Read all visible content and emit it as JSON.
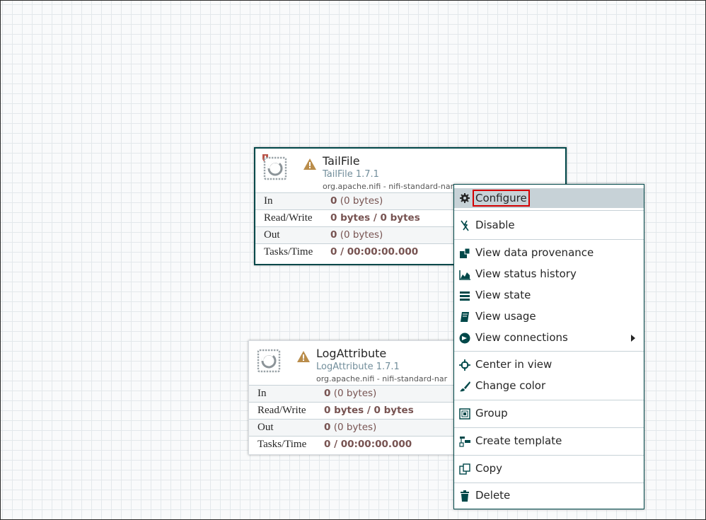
{
  "processors": {
    "tailfile": {
      "name": "TailFile",
      "type": "TailFile 1.7.1",
      "bundle": "org.apache.nifi - nifi-standard-nar",
      "stats": {
        "in_label": "In",
        "in_value": "0",
        "in_detail": "(0 bytes)",
        "rw_label": "Read/Write",
        "rw_value": "0 bytes / 0 bytes",
        "out_label": "Out",
        "out_value": "0",
        "out_detail": "(0 bytes)",
        "tasks_label": "Tasks/Time",
        "tasks_value": "0 / 00:00:00.000"
      }
    },
    "logattribute": {
      "name": "LogAttribute",
      "type": "LogAttribute 1.7.1",
      "bundle": "org.apache.nifi - nifi-standard-nar",
      "stats": {
        "in_label": "In",
        "in_value": "0",
        "in_detail": "(0 bytes)",
        "rw_label": "Read/Write",
        "rw_value": "0 bytes / 0 bytes",
        "out_label": "Out",
        "out_value": "0",
        "out_detail": "(0 bytes)",
        "tasks_label": "Tasks/Time",
        "tasks_value": "0 / 00:00:00.000"
      }
    }
  },
  "context_menu": {
    "items": [
      {
        "label": "Configure",
        "icon": "gear-icon"
      },
      {
        "label": "Disable",
        "icon": "disable-icon"
      },
      {
        "label": "View data provenance",
        "icon": "provenance-icon"
      },
      {
        "label": "View status history",
        "icon": "area-chart-icon"
      },
      {
        "label": "View state",
        "icon": "state-icon"
      },
      {
        "label": "View usage",
        "icon": "book-icon"
      },
      {
        "label": "View connections",
        "icon": "connections-icon"
      },
      {
        "label": "Center in view",
        "icon": "crosshair-icon"
      },
      {
        "label": "Change color",
        "icon": "paintbrush-icon"
      },
      {
        "label": "Group",
        "icon": "group-icon"
      },
      {
        "label": "Create template",
        "icon": "template-icon"
      },
      {
        "label": "Copy",
        "icon": "copy-icon"
      },
      {
        "label": "Delete",
        "icon": "trash-icon"
      }
    ]
  },
  "colors": {
    "accent_dark_teal": "#004849",
    "highlight_bg": "#c7d2d7",
    "highlight_outline": "#d40000",
    "stat_value": "#775351",
    "type_text": "#728e9b",
    "warning": "#ba8d4b"
  }
}
